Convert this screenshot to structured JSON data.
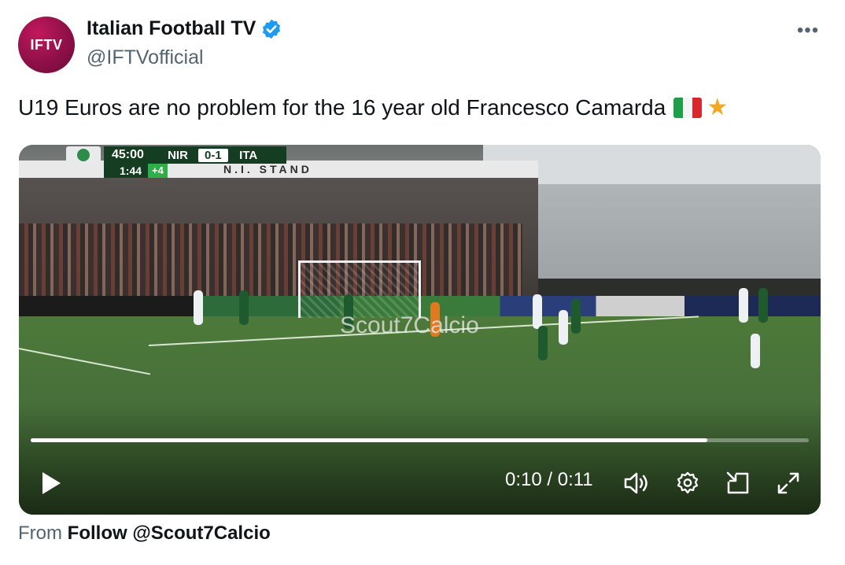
{
  "author": {
    "avatar_text": "IFTV",
    "display_name": "Italian Football TV",
    "handle": "@IFTVofficial",
    "verified": true
  },
  "tweet": {
    "text": "U19 Euros are no problem for the 16 year old Francesco Camarda",
    "emojis": [
      "italy-flag",
      "star"
    ]
  },
  "video": {
    "scoreboard": {
      "match_time": "45:00",
      "home_team": "NIR",
      "score": "0-1",
      "away_team": "ITA",
      "clock": "1:44",
      "added_time": "+4"
    },
    "stand_label": "N.I. STAND",
    "watermark": "Scout7Calcio",
    "progress": 0.87,
    "time_display": "0:10 / 0:11",
    "controls": [
      "play-icon",
      "volume-icon",
      "settings-icon",
      "pip-icon",
      "fullscreen-icon"
    ]
  },
  "source": {
    "prefix": "From",
    "label": "Follow @Scout7Calcio"
  },
  "colors": {
    "verified": "#1d9bf0",
    "avatar": "#8e1048",
    "secondary_text": "#536471"
  }
}
